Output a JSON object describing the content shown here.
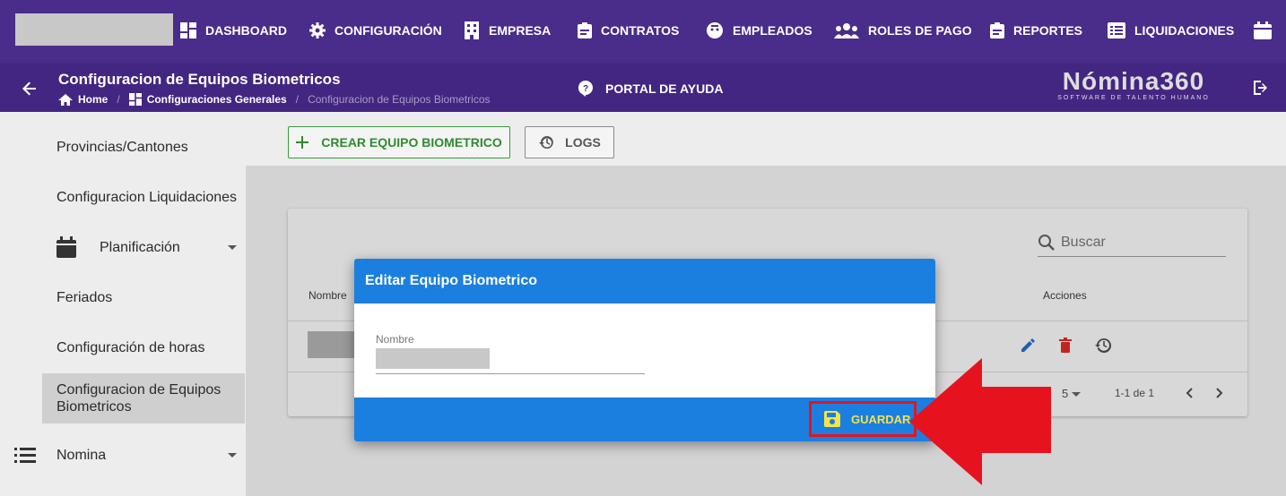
{
  "nav": {
    "items": [
      {
        "label": "DASHBOARD",
        "icon": "dashboard-icon"
      },
      {
        "label": "CONFIGURACIÓN",
        "icon": "gear-icon"
      },
      {
        "label": "EMPRESA",
        "icon": "building-icon"
      },
      {
        "label": "CONTRATOS",
        "icon": "clipboard-icon"
      },
      {
        "label": "EMPLEADOS",
        "icon": "face-icon"
      },
      {
        "label": "ROLES DE PAGO",
        "icon": "group-icon"
      },
      {
        "label": "REPORTES",
        "icon": "clipboard-icon"
      },
      {
        "label": "LIQUIDACIONES",
        "icon": "list-icon"
      }
    ]
  },
  "header": {
    "title": "Configuracion de Equipos Biometricos",
    "breadcrumb": [
      "Home",
      "Configuraciones Generales",
      "Configuracion de Equipos Biometricos"
    ],
    "help_label": "PORTAL DE AYUDA",
    "brand_name": "Nómina360",
    "brand_tagline": "SOFTWARE DE TALENTO HUMANO"
  },
  "sidebar": {
    "items": [
      "Provincias/Cantones",
      "Configuracion Liquidaciones",
      "Planificación",
      "Feriados",
      "Configuración de horas",
      "Configuracion de Equipos Biometricos",
      "Nomina"
    ]
  },
  "toolbar": {
    "create_label": "CREAR EQUIPO BIOMETRICO",
    "logs_label": "LOGS"
  },
  "table": {
    "search_placeholder": "Buscar",
    "col_name": "Nombre",
    "col_actions": "Acciones",
    "rows_per_page": "5",
    "range": "1-1 de 1"
  },
  "dialog": {
    "title": "Editar Equipo Biometrico",
    "field_label": "Nombre",
    "save_label": "GUARDAR"
  },
  "colors": {
    "nav_bg": "#4a2c8a",
    "dialog_blue": "#1b7fe0",
    "highlight_red": "#e6131f"
  }
}
